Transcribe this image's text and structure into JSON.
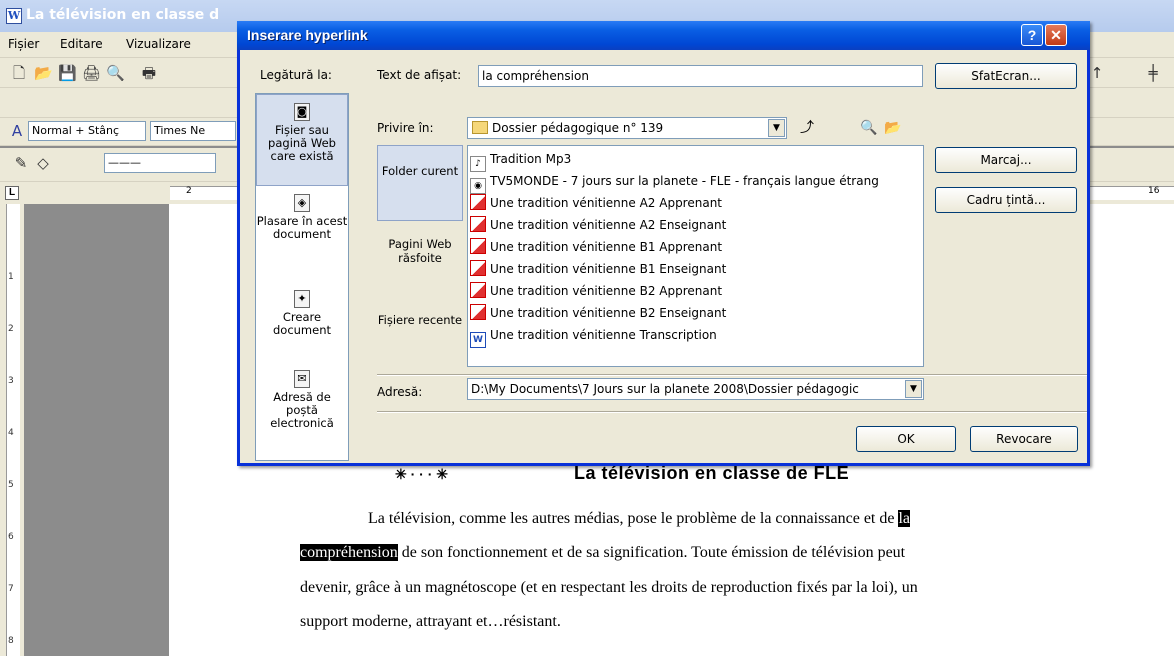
{
  "word": {
    "title": "La télévision en classe d",
    "menu": [
      "Fișier",
      "Editare",
      "Vizualizare"
    ],
    "style_combo": "Normal + Stânç",
    "font_combo": "Times Ne",
    "line_combo": "———",
    "ruler_v_numbers": [
      "1",
      "2",
      "3",
      "4",
      "5",
      "6",
      "7",
      "8"
    ],
    "ruler_h_left": "2",
    "ruler_h_right": "16"
  },
  "dialog": {
    "title": "Inserare hyperlink",
    "link_to_label": "Legătură la:",
    "link_to_items": [
      {
        "label": "Fișier sau pagină Web care există",
        "icon": "web-page-icon"
      },
      {
        "label": "Plasare în acest document",
        "icon": "document-place-icon"
      },
      {
        "label": "Creare document",
        "icon": "new-document-icon"
      },
      {
        "label": "Adresă de poștă electronică",
        "icon": "email-icon"
      }
    ],
    "display_text_label": "Text de afișat:",
    "display_text_value": "la compréhension",
    "screentip_button": "SfatEcran...",
    "look_in_label": "Privire în:",
    "look_in_value": "Dossier pédagogique n° 139",
    "look_in_items": [
      "Folder curent",
      "Pagini Web răsfoite",
      "Fișiere recente"
    ],
    "files": [
      {
        "name": "Tradition Mp3",
        "icon": "audio-file-icon"
      },
      {
        "name": "TV5MONDE - 7 jours sur la planete - FLE - français langue étrang",
        "icon": "web-shortcut-icon"
      },
      {
        "name": "Une tradition vénitienne A2 Apprenant",
        "icon": "pdf-file-icon"
      },
      {
        "name": "Une tradition vénitienne A2 Enseignant",
        "icon": "pdf-file-icon"
      },
      {
        "name": "Une tradition vénitienne B1 Apprenant",
        "icon": "pdf-file-icon"
      },
      {
        "name": "Une tradition vénitienne B1 Enseignant",
        "icon": "pdf-file-icon"
      },
      {
        "name": "Une tradition vénitienne B2 Apprenant",
        "icon": "pdf-file-icon"
      },
      {
        "name": "Une tradition vénitienne B2 Enseignant",
        "icon": "pdf-file-icon"
      },
      {
        "name": "Une tradition vénitienne Transcription",
        "icon": "word-file-icon"
      }
    ],
    "bookmark_button": "Marcaj...",
    "target_frame_button": "Cadru țintă...",
    "address_label": "Adresă:",
    "address_value": "D:\\My Documents\\7 Jours sur la planete 2008\\Dossier pédagogic",
    "ok_button": "OK",
    "cancel_button": "Revocare"
  },
  "document": {
    "heading": "La télévision en classe de FLE",
    "lines": [
      {
        "pre": "La télévision, comme les autres médias, pose le problème de la connaissance et de ",
        "hl": "la",
        "post": ""
      },
      {
        "pre": "",
        "hl": "compréhension",
        "post": " de son fonctionnement et de  sa  signification. Toute émission de télévision peut"
      },
      {
        "pre": "devenir, grâce à un magnétoscope (et en respectant les droits de reproduction fixés par la loi), un",
        "hl": "",
        "post": ""
      },
      {
        "pre": "support moderne, attrayant et…résistant.",
        "hl": "",
        "post": ""
      }
    ]
  },
  "colors": {
    "title_blue": "#0a5fe4",
    "close_red": "#c23a16",
    "highlight": "#000000"
  }
}
